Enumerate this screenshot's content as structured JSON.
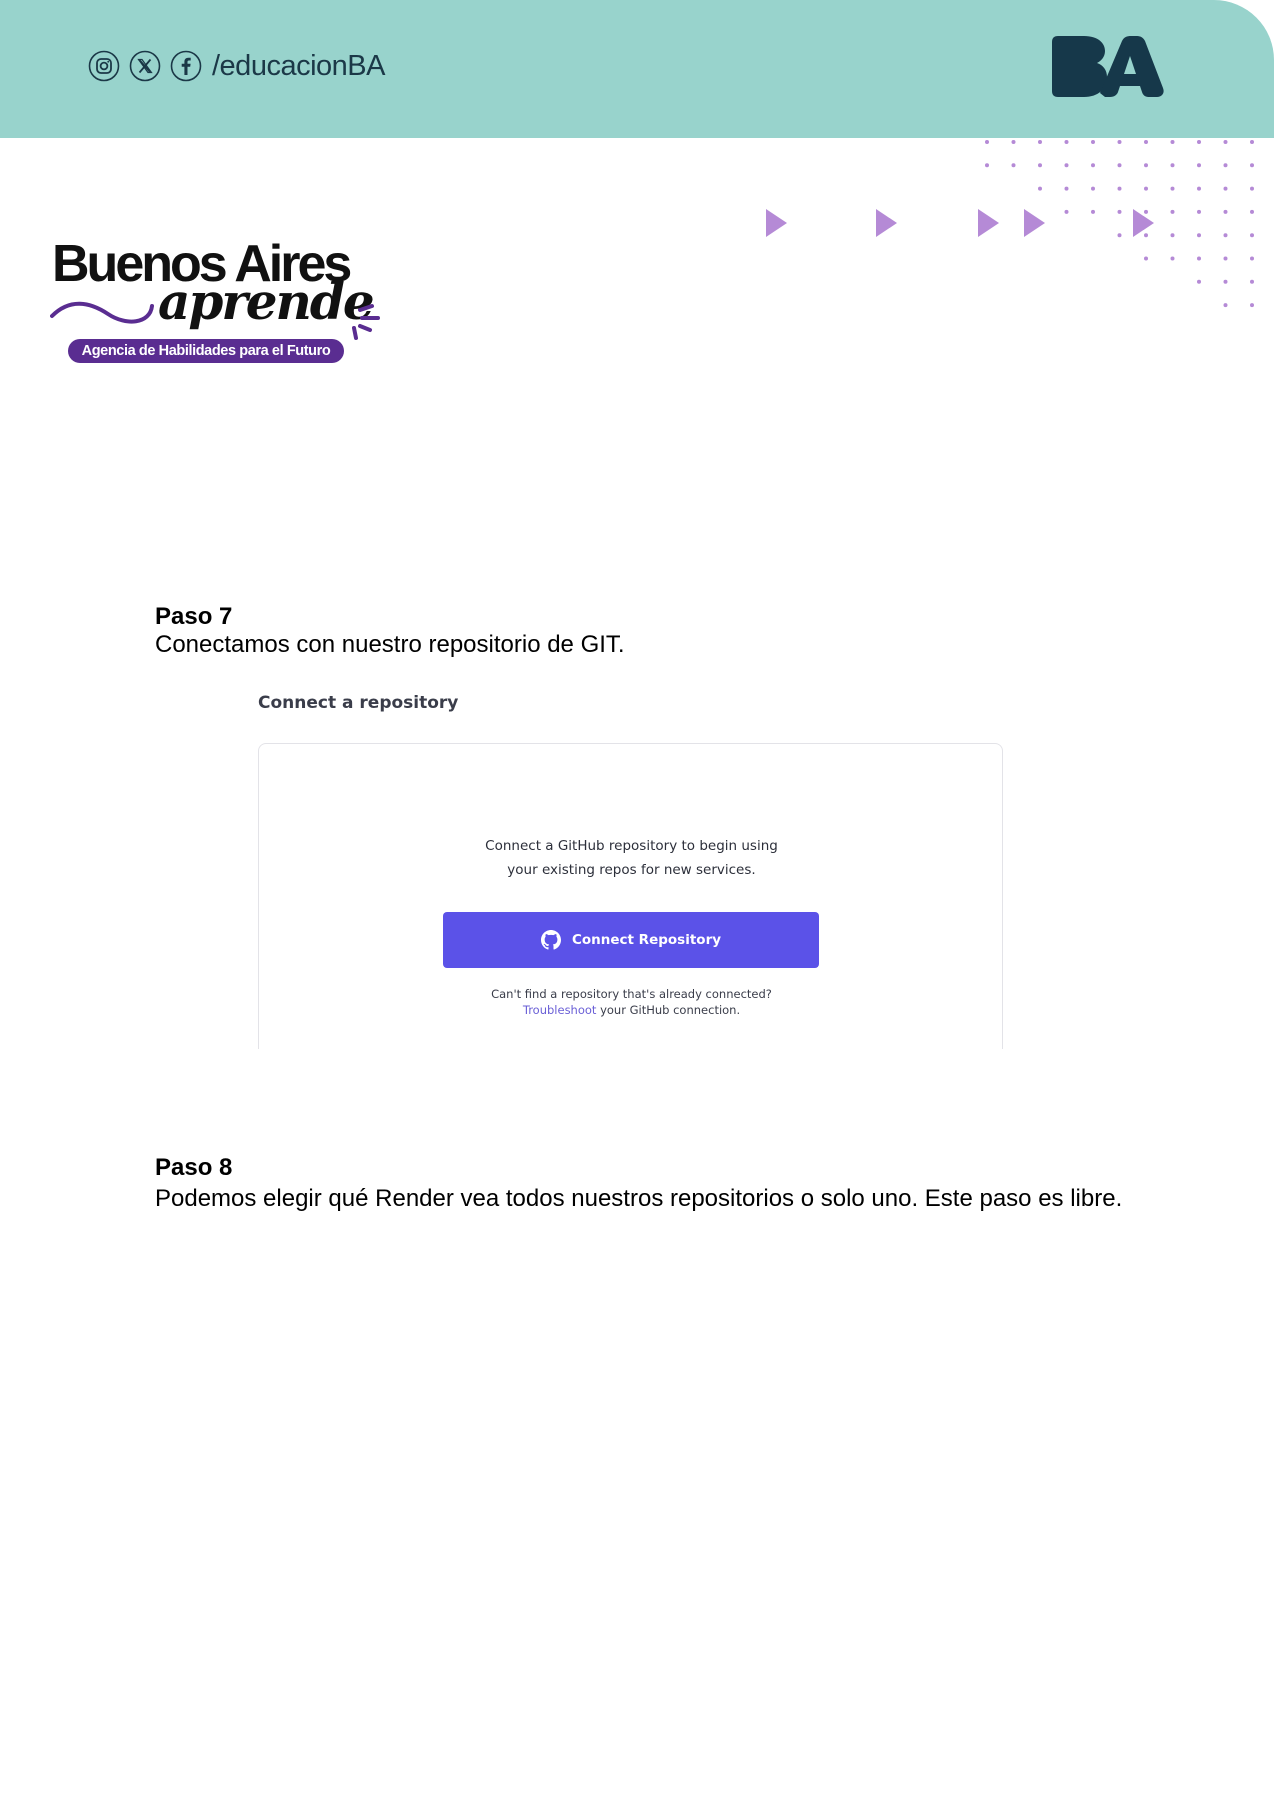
{
  "header": {
    "social_handle": "/educacionBA",
    "social_icons": [
      "instagram-icon",
      "x-icon",
      "facebook-icon"
    ],
    "logo_text": "BA",
    "background_color": "#98d3cc",
    "logo_color": "#16384a"
  },
  "brand": {
    "title": "Buenos Aires",
    "subtitle": "aprende",
    "tagline": "Agencia de Habilidades para el Futuro",
    "accent_color": "#5a2d91"
  },
  "decorations": {
    "arrow_color": "#b58ad6",
    "dot_color": "#b58ad6"
  },
  "step7": {
    "title": "Paso 7",
    "text": "Conectamos con nuestro repositorio de GIT."
  },
  "screenshot": {
    "heading": "Connect a repository",
    "description_line1": "Connect a GitHub repository to begin using",
    "description_line2": "your existing repos for new services.",
    "button_label": "Connect Repository",
    "button_icon": "github-icon",
    "button_color": "#5b52e8",
    "help_line1": "Can't find a repository that's already connected?",
    "help_link": "Troubleshoot",
    "help_line2_rest": " your GitHub connection."
  },
  "step8": {
    "title": "Paso 8",
    "text": "Podemos elegir qué Render vea todos nuestros repositorios o solo uno. Este paso es libre."
  }
}
